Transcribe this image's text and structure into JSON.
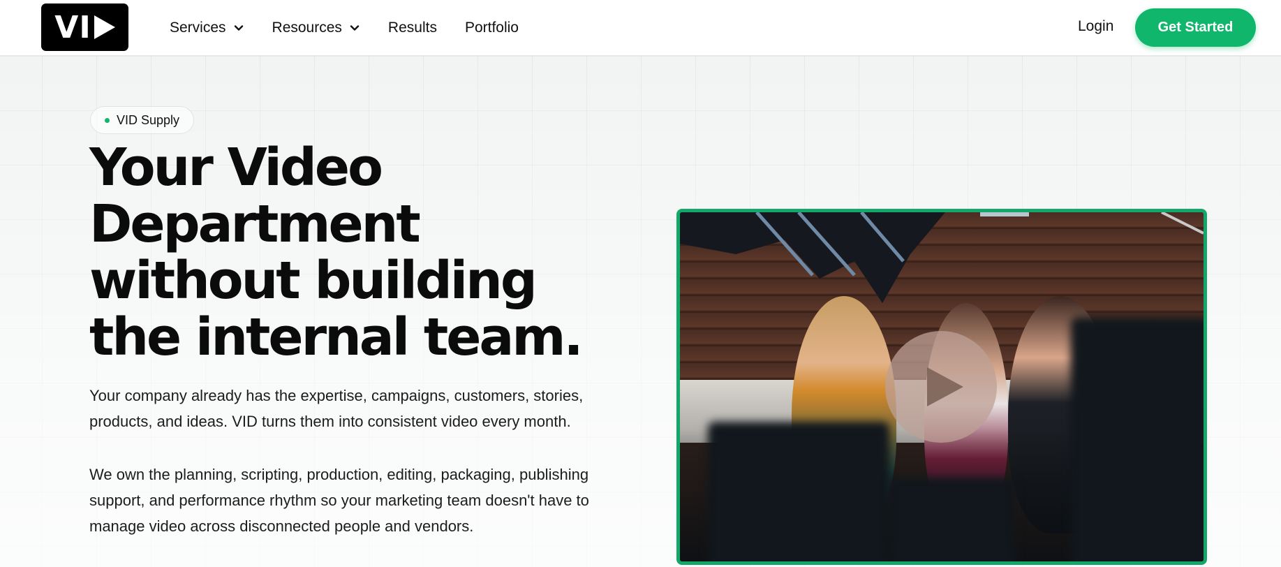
{
  "header": {
    "logo_text": "VI",
    "nav": [
      {
        "label": "Services",
        "has_dropdown": true
      },
      {
        "label": "Resources",
        "has_dropdown": true
      },
      {
        "label": "Results",
        "has_dropdown": false
      },
      {
        "label": "Portfolio",
        "has_dropdown": false
      }
    ],
    "login_label": "Login",
    "cta_label": "Get Started"
  },
  "hero": {
    "badge_label": "VID Supply",
    "headline": "Your Video Department without building the internal team.",
    "paragraph_1": "Your company already has the expertise, campaigns, customers, stories, products, and ideas. VID turns them into consistent video every month.",
    "paragraph_2": "We own the planning, scripting, production, editing, packaging, publishing support, and performance rhythm so your marketing team doesn't have to manage video across disconnected people and vendors."
  },
  "colors": {
    "accent": "#10b66b",
    "video_border": "#13a86a",
    "logo_bg": "#000000"
  },
  "icons": {
    "dropdown": "chevron-down-icon",
    "play": "play-icon"
  }
}
